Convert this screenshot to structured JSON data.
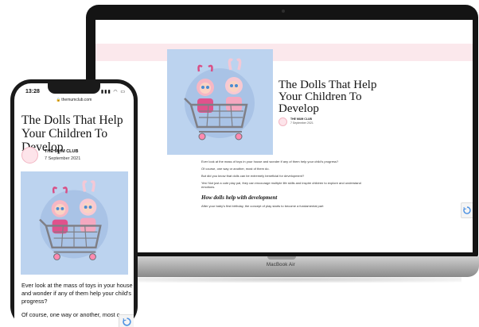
{
  "laptop": {
    "article": {
      "title": "The Dolls That Help Your Children To Develop",
      "author": "THE MUM CLUB",
      "date": "7 September 2021",
      "paragraphs": [
        "Ever look at the mass of toys in your house and wonder if any of them help your child's progress?",
        "Of course, one way or another, most of them do.",
        "But did you know that dolls can be extremely beneficial for development?",
        "Yes! Not just a cute play pal, they can encourage multiple life skills and inspire children to explore and understand emotions."
      ],
      "subheading": "How dolls help with development",
      "closing_paragraph": "After your baby's first birthday, the concept of play starts to become a fundamental part"
    },
    "brand": "MacBook Air",
    "icons": {
      "recaptcha": "recaptcha-icon",
      "camera": "camera-icon"
    }
  },
  "phone": {
    "status": {
      "time": "13:28",
      "icons": "signal-wifi-battery-icons"
    },
    "url": "themumclub.com",
    "article": {
      "title": "The Dolls That Help Your Children To Develop",
      "author": "THE MUM CLUB",
      "date": "7 September 2021",
      "paragraphs": [
        "Ever look at the mass of toys in your house and wonder if any of them help your child's progress?",
        "Of course, one way or another, most o"
      ]
    },
    "icons": {
      "recaptcha": "recaptcha-icon",
      "lock": "lock-icon"
    }
  },
  "colors": {
    "hero_background": "#bcd3ef",
    "site_bar": "#fbe8ec",
    "avatar_pink": "#fde4ea",
    "device_frame": "#1a1a1a"
  }
}
